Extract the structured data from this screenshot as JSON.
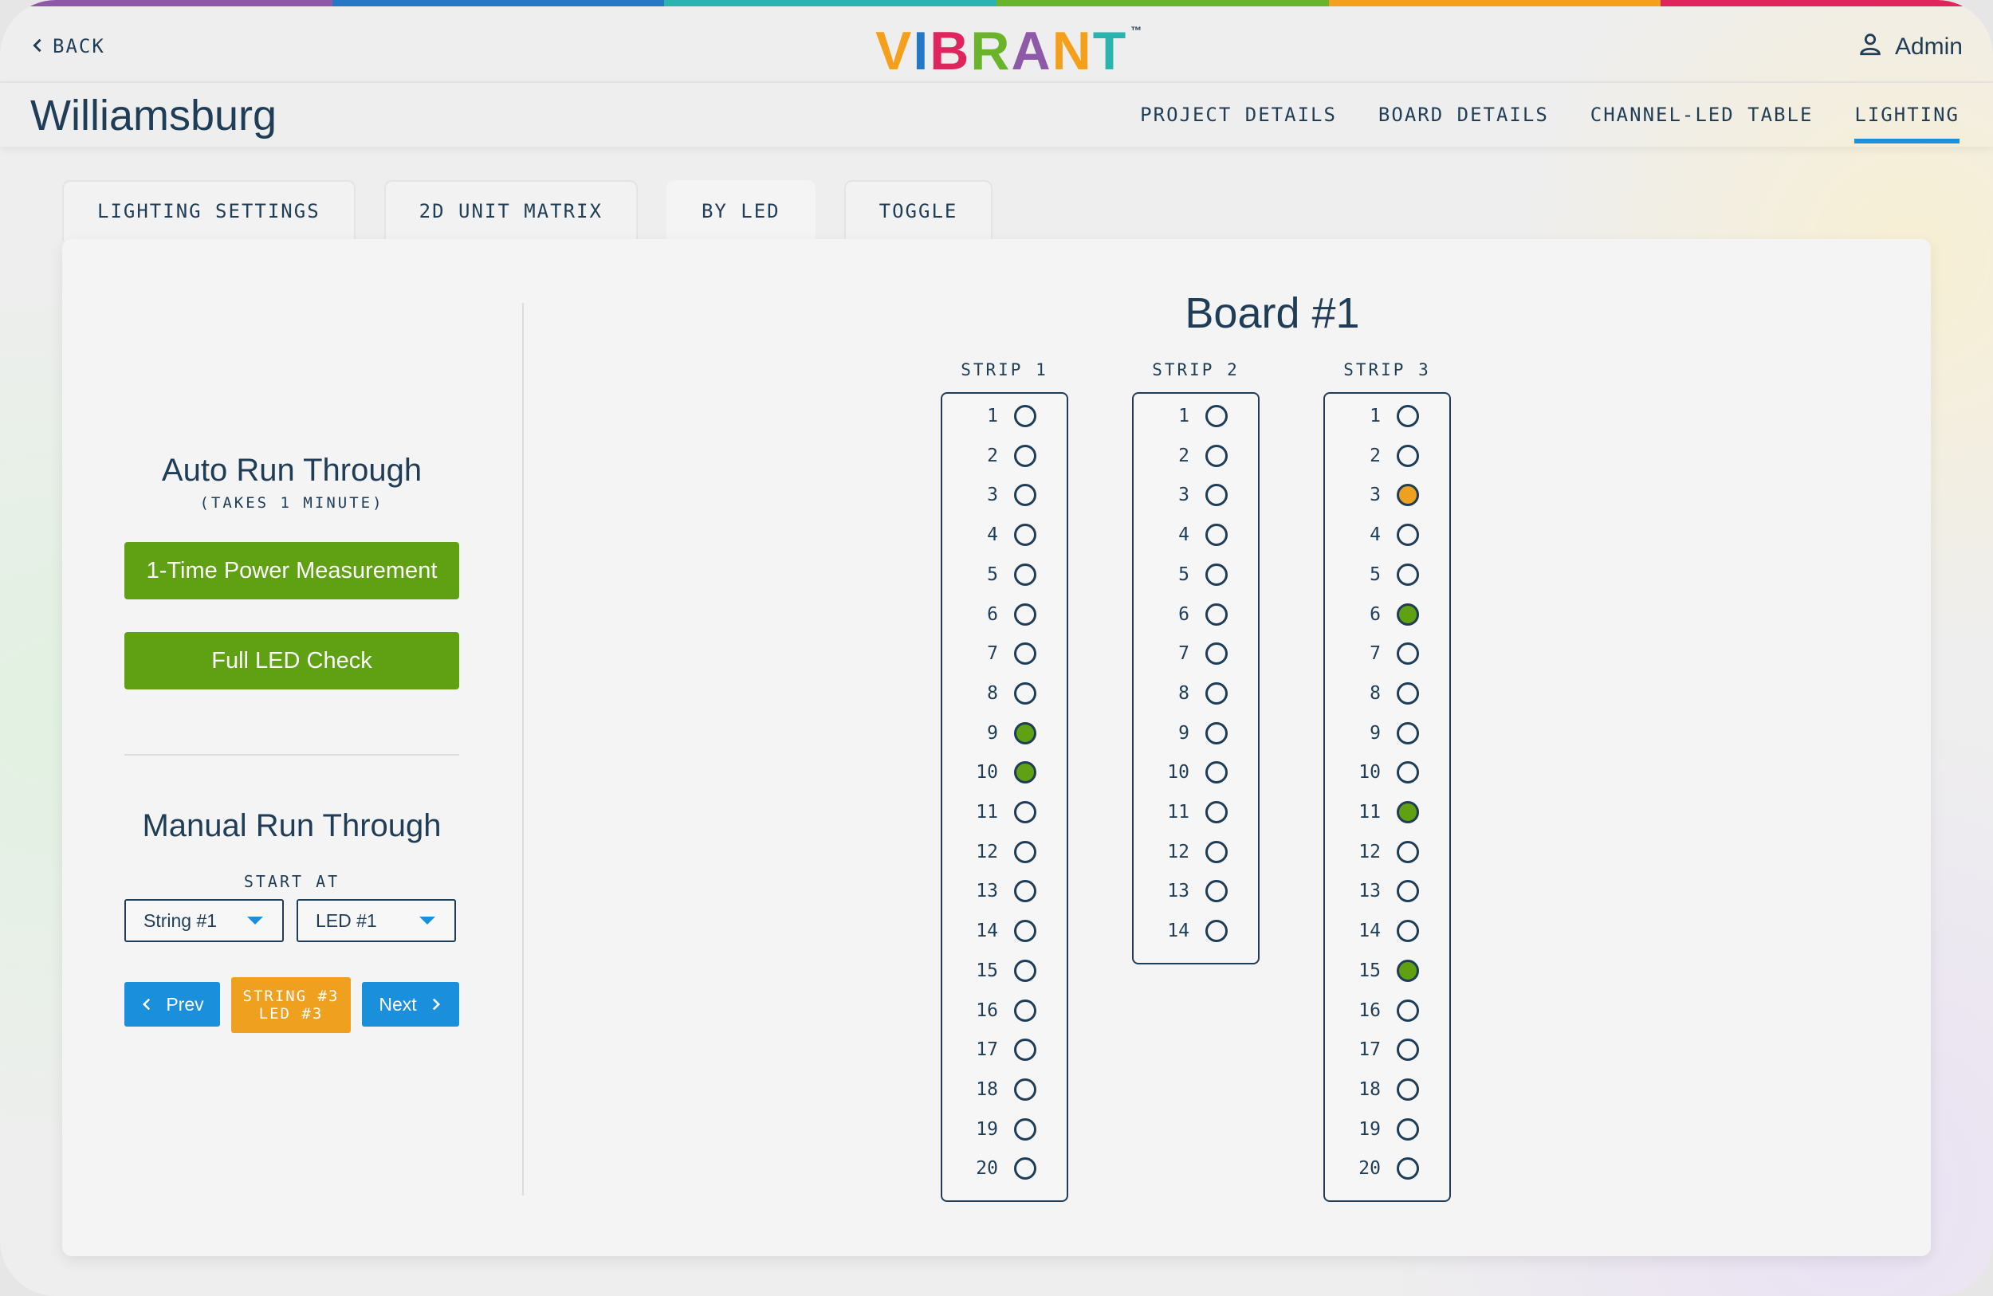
{
  "colors": {
    "rainbow": [
      "#8e5aa8",
      "#2778c4",
      "#2bb3b0",
      "#6ab42c",
      "#f4a01c",
      "#e0245e"
    ],
    "accent_blue": "#1a8fdb",
    "primary_green": "#5fa113",
    "highlight_orange": "#f0a01f",
    "text_navy": "#1f3d57",
    "led_green": "#5fa113",
    "led_orange": "#f0a01f"
  },
  "header": {
    "back_label": "BACK",
    "logo": {
      "text": "VIBRANT",
      "tm": "™",
      "letter_colors": [
        "#f4a01c",
        "#2778c4",
        "#e0245e",
        "#6ab42c",
        "#8e5aa8",
        "#f4a01c",
        "#2bb3b0"
      ]
    },
    "user_label": "Admin",
    "user_icon": "person-icon",
    "back_icon": "chevron-left-icon"
  },
  "subheader": {
    "project_title": "Williamsburg",
    "nav": [
      {
        "label": "PROJECT DETAILS",
        "active": false
      },
      {
        "label": "BOARD DETAILS",
        "active": false
      },
      {
        "label": "CHANNEL-LED TABLE",
        "active": false
      },
      {
        "label": "LIGHTING",
        "active": true
      }
    ]
  },
  "tabs": [
    {
      "label": "LIGHTING SETTINGS",
      "active": false
    },
    {
      "label": "2D UNIT MATRIX",
      "active": false
    },
    {
      "label": "BY LED",
      "active": true
    },
    {
      "label": "TOGGLE",
      "active": false
    }
  ],
  "left": {
    "auto_title": "Auto Run Through",
    "auto_subtitle": "(TAKES 1 MINUTE)",
    "power_button": "1-Time Power Measurement",
    "led_check_button": "Full LED Check",
    "manual_title": "Manual Run Through",
    "start_at_label": "START AT",
    "string_select": "String #1",
    "led_select": "LED #1",
    "prev_label": "Prev",
    "next_label": "Next",
    "current_line1": "STRING #3",
    "current_line2": "LED #3"
  },
  "board": {
    "title": "Board #1",
    "strips": [
      {
        "label": "STRIP 1",
        "count": 20,
        "leds": {
          "9": "green",
          "10": "green"
        }
      },
      {
        "label": "STRIP 2",
        "count": 14,
        "leds": {}
      },
      {
        "label": "STRIP 3",
        "count": 20,
        "leds": {
          "3": "orange",
          "6": "green",
          "11": "green",
          "15": "green"
        }
      }
    ]
  }
}
